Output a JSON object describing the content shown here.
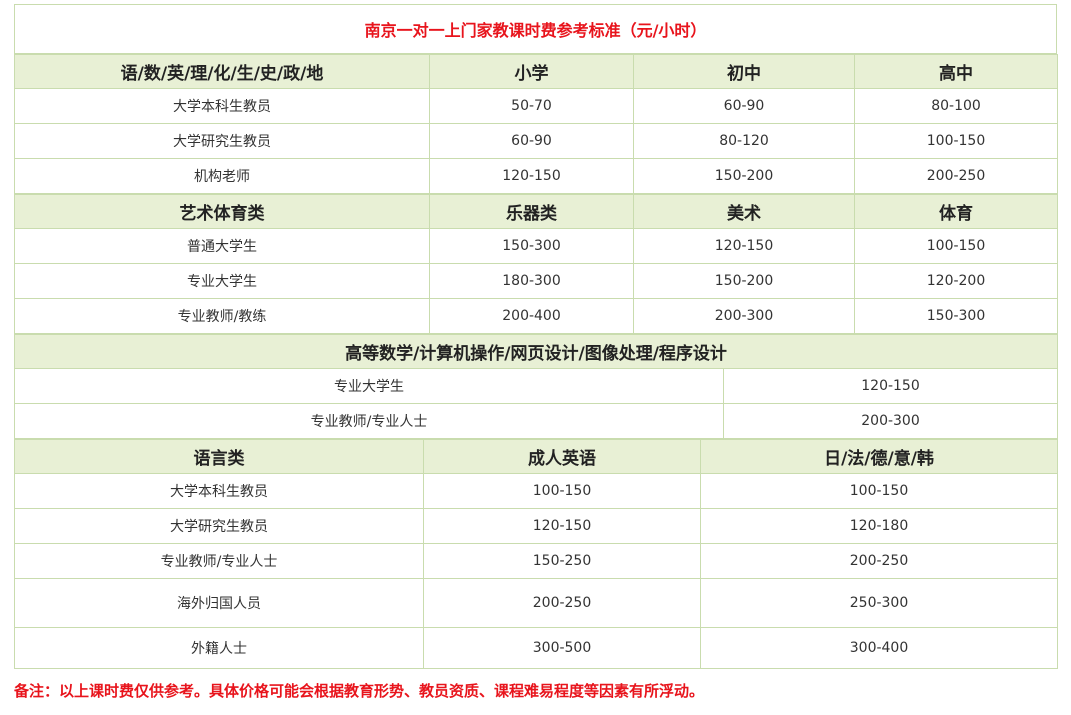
{
  "title": "南京一对一上门家教课时费参考标准（元/小时）",
  "section1": {
    "headers": [
      "语/数/英/理/化/生/史/政/地",
      "小学",
      "初中",
      "高中"
    ],
    "rows": [
      [
        "大学本科生教员",
        "50-70",
        "60-90",
        "80-100"
      ],
      [
        "大学研究生教员",
        "60-90",
        "80-120",
        "100-150"
      ],
      [
        "机构老师",
        "120-150",
        "150-200",
        "200-250"
      ]
    ]
  },
  "section2": {
    "headers": [
      "艺术体育类",
      "乐器类",
      "美术",
      "体育"
    ],
    "rows": [
      [
        "普通大学生",
        "150-300",
        "120-150",
        "100-150"
      ],
      [
        "专业大学生",
        "180-300",
        "150-200",
        "120-200"
      ],
      [
        "专业教师/教练",
        "200-400",
        "200-300",
        "150-300"
      ]
    ]
  },
  "section3": {
    "header": "高等数学/计算机操作/网页设计/图像处理/程序设计",
    "rows": [
      [
        "专业大学生",
        "120-150"
      ],
      [
        "专业教师/专业人士",
        "200-300"
      ]
    ]
  },
  "section4": {
    "headers": [
      "语言类",
      "成人英语",
      "日/法/德/意/韩"
    ],
    "rows": [
      [
        "大学本科生教员",
        "100-150",
        "100-150"
      ],
      [
        "大学研究生教员",
        "120-150",
        "120-180"
      ],
      [
        "专业教师/专业人士",
        "150-250",
        "200-250"
      ],
      [
        "海外归国人员",
        "200-250",
        "250-300"
      ],
      [
        "外籍人士",
        "300-500",
        "300-400"
      ]
    ]
  },
  "note": "备注：以上课时费仅供参考。具体价格可能会根据教育形势、教员资质、课程难易程度等因素有所浮动。",
  "colors": {
    "accent_red": "#e8141c",
    "header_bg": "#e8f0d5",
    "border": "#c9dcae"
  }
}
